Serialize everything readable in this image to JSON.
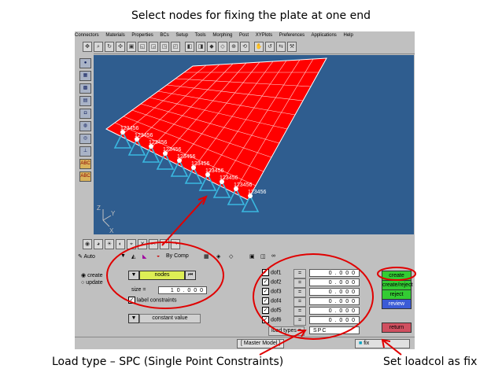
{
  "slide": {
    "title": "Select nodes for fixing the plate at one end",
    "caption_left": "Load type – SPC (Single Point Constraints)",
    "caption_right": "Set loadcol as fix"
  },
  "menubar": {
    "items": [
      "Connectors",
      "Materials",
      "Properties",
      "BCs",
      "Setup",
      "Tools",
      "Morphing",
      "Post",
      "XYPlots",
      "Preferences",
      "Applications",
      "Help"
    ]
  },
  "viewport": {
    "node_label": "123456",
    "axis_z": "Z",
    "axis_y": "Y",
    "axis_x": "X",
    "plate_color": "#ff0000",
    "background_color": "#2f5d8f",
    "constraint_color": "#3ab8e0"
  },
  "panel": {
    "auto_label": "Auto",
    "bycomp_label": "By Comp",
    "mode_create": "create",
    "mode_update": "update",
    "selector_label": "nodes",
    "size_label": "size =",
    "size_value": "1 0 . 0 0 0",
    "label_constraints": "label constraints",
    "constant_value": "constant value",
    "dofs": [
      {
        "label": "dof1",
        "value": "0 . 0 0 0"
      },
      {
        "label": "dof2",
        "value": "0 . 0 0 0"
      },
      {
        "label": "dof3",
        "value": "0 . 0 0 0"
      },
      {
        "label": "dof4",
        "value": "0 . 0 0 0"
      },
      {
        "label": "dof5",
        "value": "0 . 0 0 0"
      },
      {
        "label": "dof6",
        "value": "0 . 0 0 0"
      }
    ],
    "eq": "=",
    "load_types_label": "load types =",
    "load_types_value": "SPC",
    "buttons": {
      "create": "create",
      "create_reject": "create/reject",
      "reject": "reject",
      "review": "review",
      "return": "return"
    },
    "colors": {
      "create": "#33cc33",
      "reject": "#33cc33",
      "review": "#3b5bd6",
      "return": "#d05060",
      "selector": "#ddee55",
      "annotation": "#e00000"
    }
  },
  "status": {
    "model": "Master Model",
    "loadcol": "fix"
  }
}
